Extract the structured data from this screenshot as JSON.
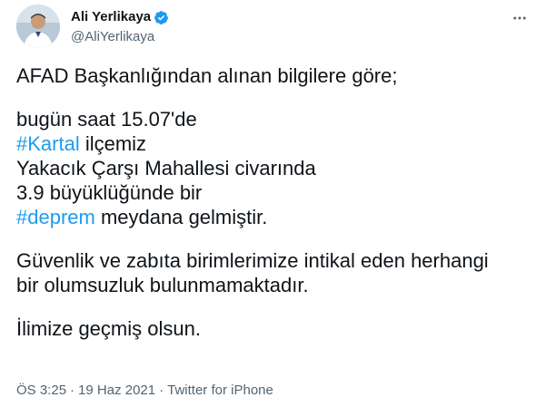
{
  "author": {
    "display_name": "Ali Yerlikaya",
    "handle": "@AliYerlikaya",
    "verified": true,
    "verified_color": "#1d9bf0"
  },
  "tweet": {
    "line1": "AFAD Başkanlığından alınan bilgilere göre;",
    "line2": "bugün saat 15.07'de",
    "line3_hashtag": "#Kartal",
    "line3_rest": " ilçemiz",
    "line4": "Yakacık Çarşı Mahallesi civarında",
    "line5": "3.9 büyüklüğünde bir",
    "line6_hashtag": "#deprem",
    "line6_rest": " meydana gelmiştir.",
    "line7": "Güvenlik ve zabıta birimlerimize intikal eden herhangi",
    "line8": "bir olumsuzluk bulunmamaktadır.",
    "line9": "İlimize geçmiş olsun."
  },
  "meta": {
    "time": "ÖS 3:25",
    "separator": "·",
    "date": "19 Haz 2021",
    "source": "Twitter for iPhone"
  },
  "colors": {
    "link": "#1d9bf0",
    "text": "#0f1419",
    "secondary": "#536471"
  },
  "icons": {
    "more": "more-horizontal-icon",
    "verified": "verified-badge-icon"
  }
}
